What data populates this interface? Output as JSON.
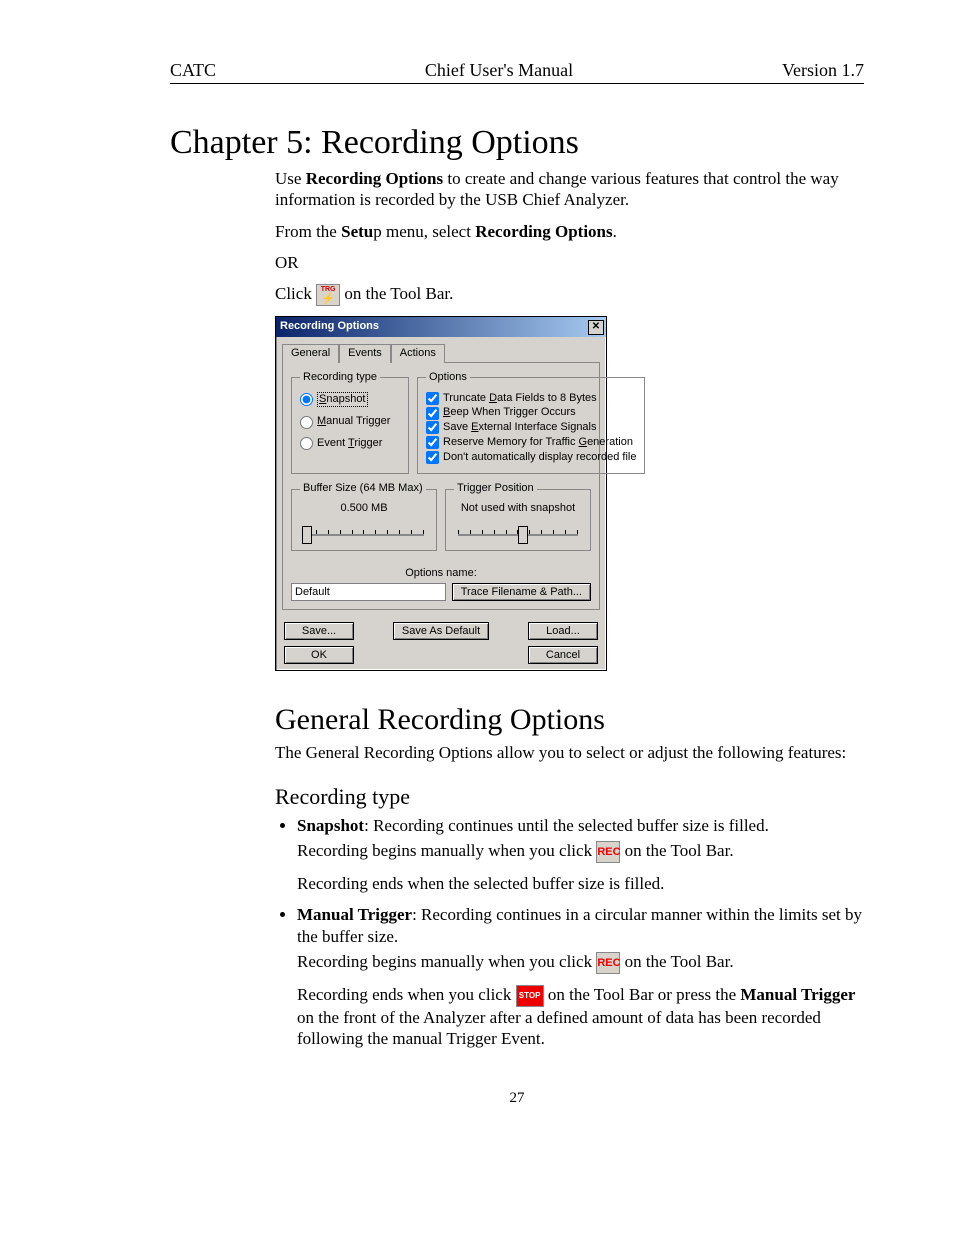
{
  "header": {
    "left": "CATC",
    "center": "Chief User's Manual",
    "right": "Version 1.7"
  },
  "chapter_title": "Chapter 5: Recording Options",
  "intro": {
    "p1a": "Use ",
    "p1b": "Recording Options",
    "p1c": " to create and change various features that control the way information is recorded by the USB Chief Analyzer.",
    "p2a": "From the ",
    "p2b": "Setu",
    "p2c": "p menu, select ",
    "p2d": "Recording Options",
    "p2e": ".",
    "or": "OR",
    "click_pre": "Click ",
    "click_post": " on the Tool Bar."
  },
  "dialog": {
    "title": "Recording Options",
    "close": "✕",
    "tabs": [
      "General",
      "Events",
      "Actions"
    ],
    "recording_type": {
      "legend": "Recording type",
      "snapshot": "Snapshot",
      "manual": "Manual Trigger",
      "event": "Event Trigger"
    },
    "options": {
      "legend": "Options",
      "truncate": "Truncate Data Fields to 8 Bytes",
      "beep": "Beep When Trigger Occurs",
      "save_ext": "Save External Interface Signals",
      "reserve": "Reserve Memory for Traffic Generation",
      "dont_disp": "Don't automatically display recorded file"
    },
    "buffer": {
      "legend": "Buffer Size (64 MB Max)",
      "value": "0.500 MB"
    },
    "trigger_pos": {
      "legend": "Trigger Position",
      "text": "Not used with snapshot"
    },
    "options_name_label": "Options name:",
    "options_name_value": "Default",
    "trace_btn": "Trace Filename & Path...",
    "buttons": {
      "save": "Save...",
      "save_default": "Save As Default",
      "load": "Load...",
      "ok": "OK",
      "cancel": "Cancel"
    }
  },
  "section2_title": "General Recording Options",
  "section2_p": "The General Recording Options allow you to select or adjust the following features:",
  "rectype_title": "Recording type",
  "snapshot": {
    "label": "Snapshot",
    "desc": ": Recording continues until the selected buffer size is filled.",
    "sub1a": "Recording begins manually when you click ",
    "sub1b": " on the Tool Bar.",
    "sub2": "Recording ends when the selected buffer size is filled."
  },
  "manual": {
    "label": "Manual Trigger",
    "desc": ": Recording continues in a circular manner within the limits set by the buffer size.",
    "sub1a": "Recording begins manually when you click ",
    "sub1b": " on the Tool Bar.",
    "sub2a": "Recording ends when you click ",
    "sub2b": " on the Tool Bar or press the ",
    "sub2c": "Manual Trigger",
    "sub2d": " on the front of the Analyzer after a defined amount of data has been recorded following the manual Trigger Event."
  },
  "icons": {
    "rec": "REC",
    "stop": "STOP"
  },
  "page_number": "27"
}
